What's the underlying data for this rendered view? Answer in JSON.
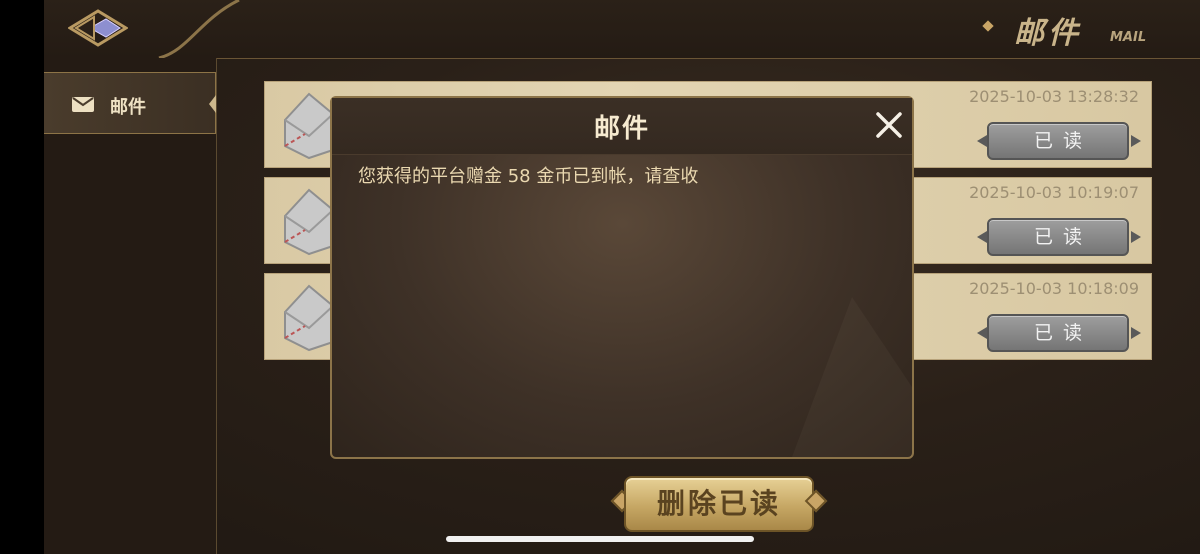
{
  "header": {
    "title_cn": "邮件",
    "title_en": "MAIL"
  },
  "sidebar": {
    "items": [
      {
        "label": "邮件",
        "icon": "envelope-icon",
        "selected": true
      }
    ]
  },
  "mails": [
    {
      "time": "2025-10-03 13:28:32",
      "status": "已读"
    },
    {
      "time": "2025-10-03 10:19:07",
      "status": "已读"
    },
    {
      "time": "2025-10-03 10:18:09",
      "status": "已读"
    }
  ],
  "dialog": {
    "title": "邮件",
    "message": "您获得的平台赠金 58 金币已到帐，请查收"
  },
  "footer": {
    "delete_label": "删除已读"
  },
  "colors": {
    "accent_gold": "#c9a566",
    "row_parchment": "#e3d5b3",
    "read_button_gray": "#8a8a8a"
  }
}
